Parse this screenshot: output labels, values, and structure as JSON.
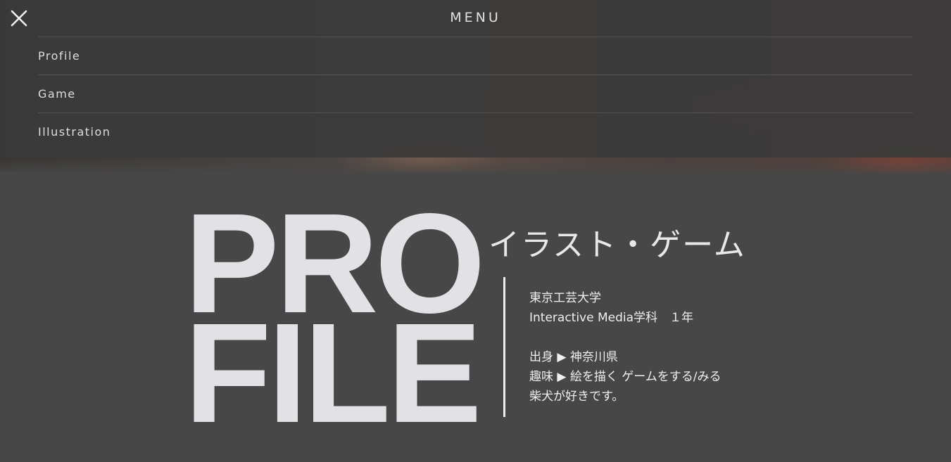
{
  "menu": {
    "title": "MENU",
    "items": [
      {
        "label": "Profile"
      },
      {
        "label": "Game"
      },
      {
        "label": "Illustration"
      }
    ]
  },
  "icons": {
    "close": "close-icon"
  },
  "profile": {
    "big_title_line1": "PRO",
    "big_title_line2": "FILE",
    "subtitle": "イラスト・ゲーム",
    "school": "東京工芸大学",
    "department": "Interactive Media学科　１年",
    "hometown": "出身 ▶ 神奈川県",
    "hobbies": "趣味 ▶ 絵を描く ゲームをする/みる",
    "likes": "柴犬が好きです。"
  },
  "colors": {
    "background": "#474747",
    "menu_overlay": "#3a3a3a",
    "text": "#e6e6e6"
  }
}
